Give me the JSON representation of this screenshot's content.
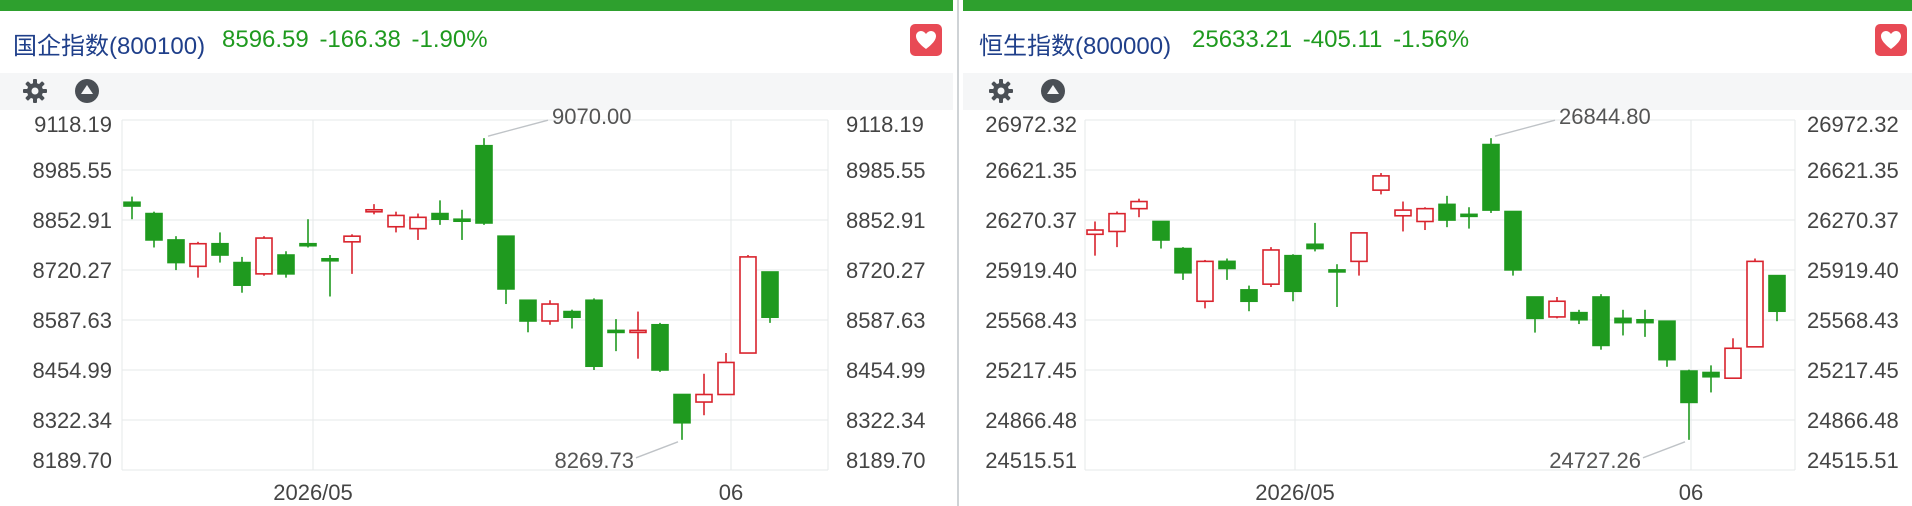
{
  "panels": [
    {
      "name": "国企指数(800100)",
      "price": "8596.59",
      "change": "-166.38",
      "pct": "-1.90%",
      "chart_data": {
        "type": "candlestick",
        "ylim": [
          8189.7,
          9118.19
        ],
        "yticks": [
          "9118.19",
          "8985.55",
          "8852.91",
          "8720.27",
          "8587.63",
          "8454.99",
          "8322.34",
          "8189.70"
        ],
        "xticks": [
          {
            "label": "2026/05",
            "index": 8
          },
          {
            "label": "06",
            "index": 27
          }
        ],
        "max_label": "9070.00",
        "min_label": "8269.73",
        "candles": [
          {
            "o": 8900,
            "h": 8915,
            "l": 8855,
            "c": 8890
          },
          {
            "o": 8870,
            "h": 8875,
            "l": 8780,
            "c": 8800
          },
          {
            "o": 8800,
            "h": 8810,
            "l": 8720,
            "c": 8740
          },
          {
            "o": 8730,
            "h": 8795,
            "l": 8700,
            "c": 8790
          },
          {
            "o": 8790,
            "h": 8820,
            "l": 8740,
            "c": 8760
          },
          {
            "o": 8740,
            "h": 8755,
            "l": 8660,
            "c": 8680
          },
          {
            "o": 8710,
            "h": 8810,
            "l": 8705,
            "c": 8805
          },
          {
            "o": 8760,
            "h": 8770,
            "l": 8700,
            "c": 8710
          },
          {
            "o": 8790,
            "h": 8855,
            "l": 8780,
            "c": 8785
          },
          {
            "o": 8750,
            "h": 8760,
            "l": 8650,
            "c": 8745
          },
          {
            "o": 8795,
            "h": 8815,
            "l": 8710,
            "c": 8810
          },
          {
            "o": 8875,
            "h": 8895,
            "l": 8868,
            "c": 8880
          },
          {
            "o": 8835,
            "h": 8875,
            "l": 8820,
            "c": 8865
          },
          {
            "o": 8830,
            "h": 8870,
            "l": 8800,
            "c": 8860
          },
          {
            "o": 8870,
            "h": 8905,
            "l": 8840,
            "c": 8855
          },
          {
            "o": 8855,
            "h": 8880,
            "l": 8800,
            "c": 8850
          },
          {
            "o": 9050,
            "h": 9070,
            "l": 8840,
            "c": 8845
          },
          {
            "o": 8810,
            "h": 8810,
            "l": 8630,
            "c": 8670
          },
          {
            "o": 8640,
            "h": 8640,
            "l": 8555,
            "c": 8585
          },
          {
            "o": 8585,
            "h": 8640,
            "l": 8575,
            "c": 8630
          },
          {
            "o": 8610,
            "h": 8615,
            "l": 8565,
            "c": 8595
          },
          {
            "o": 8640,
            "h": 8645,
            "l": 8455,
            "c": 8465
          },
          {
            "o": 8560,
            "h": 8590,
            "l": 8505,
            "c": 8555
          },
          {
            "o": 8555,
            "h": 8610,
            "l": 8485,
            "c": 8560
          },
          {
            "o": 8575,
            "h": 8580,
            "l": 8450,
            "c": 8455
          },
          {
            "o": 8390,
            "h": 8390,
            "l": 8269.73,
            "c": 8315
          },
          {
            "o": 8370,
            "h": 8445,
            "l": 8335,
            "c": 8390
          },
          {
            "o": 8390,
            "h": 8500,
            "l": 8390,
            "c": 8475
          },
          {
            "o": 8500,
            "h": 8760,
            "l": 8500,
            "c": 8755
          },
          {
            "o": 8715,
            "h": 8715,
            "l": 8580,
            "c": 8595
          }
        ]
      }
    },
    {
      "name": "恒生指数(800000)",
      "price": "25633.21",
      "change": "-405.11",
      "pct": "-1.56%",
      "chart_data": {
        "type": "candlestick",
        "ylim": [
          24515.51,
          26972.32
        ],
        "yticks": [
          "26972.32",
          "26621.35",
          "26270.37",
          "25919.40",
          "25568.43",
          "25217.45",
          "24866.48",
          "24515.51"
        ],
        "xticks": [
          {
            "label": "2026/05",
            "index": 9
          },
          {
            "label": "06",
            "index": 27
          }
        ],
        "max_label": "26844.80",
        "min_label": "24727.26",
        "candles": [
          {
            "o": 26170,
            "h": 26260,
            "l": 26020,
            "c": 26200
          },
          {
            "o": 26190,
            "h": 26330,
            "l": 26080,
            "c": 26315
          },
          {
            "o": 26350,
            "h": 26420,
            "l": 26290,
            "c": 26400
          },
          {
            "o": 26260,
            "h": 26260,
            "l": 26070,
            "c": 26130
          },
          {
            "o": 26070,
            "h": 26080,
            "l": 25850,
            "c": 25900
          },
          {
            "o": 25700,
            "h": 25990,
            "l": 25650,
            "c": 25980
          },
          {
            "o": 25980,
            "h": 26000,
            "l": 25850,
            "c": 25930
          },
          {
            "o": 25780,
            "h": 25810,
            "l": 25630,
            "c": 25700
          },
          {
            "o": 25820,
            "h": 26080,
            "l": 25800,
            "c": 26060
          },
          {
            "o": 26020,
            "h": 26030,
            "l": 25700,
            "c": 25770
          },
          {
            "o": 26100,
            "h": 26250,
            "l": 26050,
            "c": 26070
          },
          {
            "o": 25920,
            "h": 25960,
            "l": 25660,
            "c": 25910
          },
          {
            "o": 25980,
            "h": 26180,
            "l": 25880,
            "c": 26180
          },
          {
            "o": 26480,
            "h": 26600,
            "l": 26450,
            "c": 26580
          },
          {
            "o": 26300,
            "h": 26400,
            "l": 26190,
            "c": 26340
          },
          {
            "o": 26260,
            "h": 26360,
            "l": 26200,
            "c": 26350
          },
          {
            "o": 26380,
            "h": 26440,
            "l": 26220,
            "c": 26270
          },
          {
            "o": 26310,
            "h": 26360,
            "l": 26210,
            "c": 26300
          },
          {
            "o": 26800,
            "h": 26844.8,
            "l": 26320,
            "c": 26340
          },
          {
            "o": 26330,
            "h": 26330,
            "l": 25880,
            "c": 25920
          },
          {
            "o": 25730,
            "h": 25730,
            "l": 25480,
            "c": 25580
          },
          {
            "o": 25590,
            "h": 25730,
            "l": 25580,
            "c": 25700
          },
          {
            "o": 25620,
            "h": 25640,
            "l": 25540,
            "c": 25570
          },
          {
            "o": 25730,
            "h": 25750,
            "l": 25360,
            "c": 25390
          },
          {
            "o": 25580,
            "h": 25640,
            "l": 25460,
            "c": 25550
          },
          {
            "o": 25570,
            "h": 25640,
            "l": 25450,
            "c": 25550
          },
          {
            "o": 25560,
            "h": 25560,
            "l": 25240,
            "c": 25290
          },
          {
            "o": 25210,
            "h": 25220,
            "l": 24727.26,
            "c": 24990
          },
          {
            "o": 25200,
            "h": 25250,
            "l": 25060,
            "c": 25170
          },
          {
            "o": 25160,
            "h": 25440,
            "l": 25160,
            "c": 25370
          },
          {
            "o": 25380,
            "h": 26000,
            "l": 25380,
            "c": 25980
          },
          {
            "o": 25880,
            "h": 25880,
            "l": 25560,
            "c": 25630
          }
        ]
      }
    }
  ],
  "colors": {
    "up": "#d9232d",
    "down": "#1f9a1f",
    "topbar": "#2ea02e",
    "name": "#1f3f8a",
    "heart": "#e84a55"
  },
  "icons": {
    "settings": "gear-icon",
    "collapse": "triangle-up-circle-icon",
    "favorite": "heart-icon"
  }
}
